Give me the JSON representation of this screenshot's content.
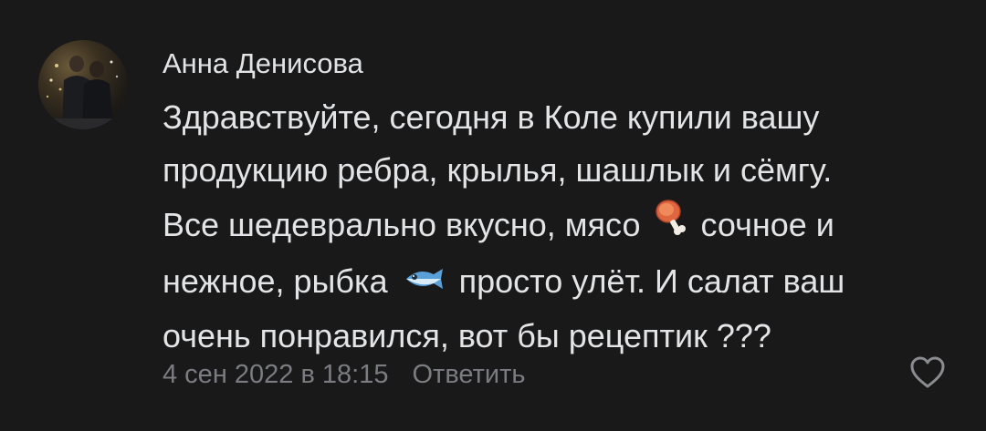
{
  "comment": {
    "author": "Анна Денисова",
    "lines": [
      {
        "before": "Здравствуйте,  сегодня в Коле купили вашу"
      },
      {
        "before": "продукцию ребра, крылья, шашлык и сёмгу."
      },
      {
        "before": "Все шедеврально вкусно, мясо",
        "emoji": "meat-on-bone-icon",
        "after": "сочное и"
      },
      {
        "before": "нежное, рыбка",
        "emoji": "fish-icon",
        "after": "просто улёт. И салат ваш"
      },
      {
        "before": "очень понравился,  вот бы рецептик ???"
      }
    ],
    "date": "4 сен 2022 в 18:15",
    "reply_label": "Ответить",
    "like_icon": "heart-outline-icon"
  },
  "colors": {
    "background": "#19191a",
    "text": "#e2e3e5",
    "secondary": "#7b7c80"
  }
}
